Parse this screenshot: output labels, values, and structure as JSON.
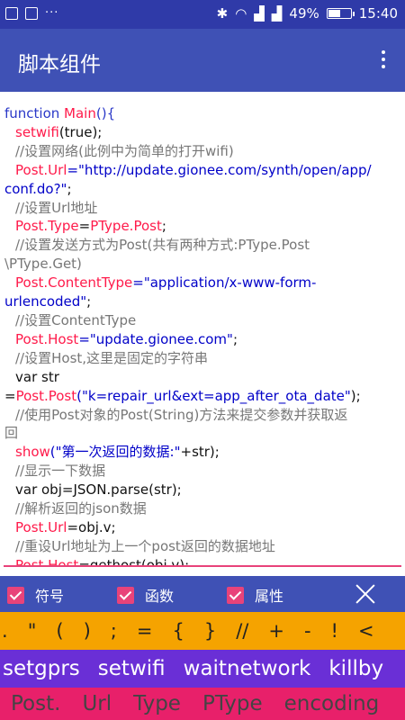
{
  "status_bar": {
    "battery": "49%",
    "battery_level": 0.49,
    "time": "15:40",
    "more": "···",
    "icons": [
      "notification-icon",
      "image-icon",
      "bluetooth-icon",
      "wifi-icon",
      "signal-icon",
      "signal2-icon",
      "battery-icon"
    ]
  },
  "app_bar": {
    "title": "脚本组件"
  },
  "code": [
    [
      {
        "t": "function ",
        "c": "fn"
      },
      {
        "t": "Main",
        "c": "kw"
      },
      {
        "t": "(){",
        "c": "fn"
      }
    ],
    [
      {
        "t": "setwifi",
        "c": "kw"
      },
      {
        "t": "(true);",
        "c": ""
      }
    ],
    [
      {
        "t": "//设置网络(此例中为简单的打开wifi)",
        "c": "cm"
      }
    ],
    [
      {
        "t": "Post.Url",
        "c": "kw"
      },
      {
        "t": "=\"http://update.gionee.com/synth/open/app/",
        "c": "str"
      }
    ],
    [
      {
        "t": "conf.do?\"",
        "c": "str"
      },
      {
        "t": ";",
        "c": ""
      }
    ],
    [
      {
        "t": "//设置Url地址",
        "c": "cm"
      }
    ],
    [
      {
        "t": "Post.Type",
        "c": "kw"
      },
      {
        "t": "=",
        "c": ""
      },
      {
        "t": "PType.Post",
        "c": "kw"
      },
      {
        "t": ";",
        "c": ""
      }
    ],
    [
      {
        "t": "//设置发送方式为Post(共有两种方式:PType.Post",
        "c": "cm"
      }
    ],
    [
      {
        "t": "\\PType.Get)",
        "c": "cm"
      }
    ],
    [
      {
        "t": "Post.ContentType",
        "c": "kw"
      },
      {
        "t": "=\"application/x-www-form-",
        "c": "str"
      }
    ],
    [
      {
        "t": "urlencoded\"",
        "c": "str"
      },
      {
        "t": ";",
        "c": ""
      }
    ],
    [
      {
        "t": "//设置ContentType",
        "c": "cm"
      }
    ],
    [
      {
        "t": "Post.Host",
        "c": "kw"
      },
      {
        "t": "=\"update.gionee.com\"",
        "c": "str"
      },
      {
        "t": ";",
        "c": ""
      }
    ],
    [
      {
        "t": "//设置Host,这里是固定的字符串",
        "c": "cm"
      }
    ],
    [
      {
        "t": "var str",
        "c": ""
      }
    ],
    [
      {
        "t": "=",
        "c": ""
      },
      {
        "t": "Post.Post",
        "c": "kw"
      },
      {
        "t": "(\"k=repair_url&ext=app_after_ota_date\"",
        "c": "str"
      },
      {
        "t": ");",
        "c": ""
      }
    ],
    [
      {
        "t": "//使用Post对象的Post(String)方法来提交参数并获取返",
        "c": "cm"
      }
    ],
    [
      {
        "t": "回",
        "c": "cm"
      }
    ],
    [
      {
        "t": "show",
        "c": "kw"
      },
      {
        "t": "(\"第一次返回的数据:\"",
        "c": "str"
      },
      {
        "t": "+str);",
        "c": ""
      }
    ],
    [
      {
        "t": "//显示一下数据",
        "c": "cm"
      }
    ],
    [
      {
        "t": "var obj=JSON.parse(str);",
        "c": ""
      }
    ],
    [
      {
        "t": "//解析返回的json数据",
        "c": "cm"
      }
    ],
    [
      {
        "t": "Post.Url",
        "c": "kw"
      },
      {
        "t": "=obj.v;",
        "c": ""
      }
    ],
    [
      {
        "t": "//重设Url地址为上一个post返回的数据地址",
        "c": "cm"
      }
    ],
    [
      {
        "t": "Post.Host",
        "c": "kw"
      },
      {
        "t": "=gethost(obj.v);",
        "c": ""
      }
    ]
  ],
  "code_indent": [
    false,
    true,
    true,
    true,
    false,
    true,
    true,
    true,
    false,
    true,
    false,
    true,
    true,
    true,
    true,
    false,
    true,
    false,
    true,
    true,
    true,
    true,
    true,
    true,
    true
  ],
  "checkboxes": [
    {
      "label": "符号",
      "checked": true
    },
    {
      "label": "函数",
      "checked": true
    },
    {
      "label": "属性",
      "checked": true
    }
  ],
  "symbols": [
    ".",
    "\"",
    "(",
    ")",
    ";",
    "=",
    "{",
    "}",
    "//",
    "+",
    "-",
    "!",
    "<"
  ],
  "functions": [
    "setgprs",
    "setwifi",
    "waitnetwork",
    "killby"
  ],
  "properties": [
    "Post.",
    "Url",
    "Type",
    "PType",
    "encoding"
  ]
}
